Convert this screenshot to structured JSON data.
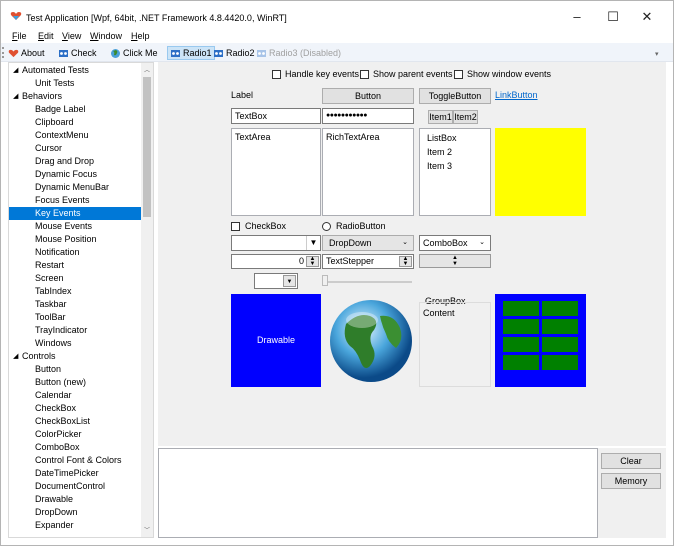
{
  "window": {
    "title": "Test Application [Wpf, 64bit, .NET Framework 4.8.4420.0, WinRT]",
    "minimize": "–",
    "maximize": "☐",
    "close": "✕"
  },
  "menu": {
    "file": {
      "u": "F",
      "rest": "ile"
    },
    "edit": {
      "u": "E",
      "rest": "dit"
    },
    "view": {
      "u": "V",
      "rest": "iew"
    },
    "window": {
      "u": "W",
      "rest": "indow"
    },
    "help": {
      "u": "H",
      "rest": "elp"
    }
  },
  "toolbar": {
    "about": "About",
    "check": "Check",
    "click_me": "Click Me",
    "radio1": "Radio1",
    "radio2": "Radio2",
    "radio3": "Radio3 (Disabled)"
  },
  "tree": {
    "items": [
      {
        "label": "Automated Tests",
        "caret": "◢"
      },
      {
        "label": "Unit Tests"
      },
      {
        "label": "Behaviors",
        "caret": "◢"
      },
      {
        "label": "Badge Label"
      },
      {
        "label": "Clipboard"
      },
      {
        "label": "ContextMenu"
      },
      {
        "label": "Cursor"
      },
      {
        "label": "Drag and Drop"
      },
      {
        "label": "Dynamic Focus"
      },
      {
        "label": "Dynamic MenuBar"
      },
      {
        "label": "Focus Events"
      },
      {
        "label": "Key Events"
      },
      {
        "label": "Mouse Events"
      },
      {
        "label": "Mouse Position"
      },
      {
        "label": "Notification"
      },
      {
        "label": "Restart"
      },
      {
        "label": "Screen"
      },
      {
        "label": "TabIndex"
      },
      {
        "label": "Taskbar"
      },
      {
        "label": "ToolBar"
      },
      {
        "label": "TrayIndicator"
      },
      {
        "label": "Windows"
      },
      {
        "label": "Controls",
        "caret": "◢"
      },
      {
        "label": "Button"
      },
      {
        "label": "Button (new)"
      },
      {
        "label": "Calendar"
      },
      {
        "label": "CheckBox"
      },
      {
        "label": "CheckBoxList"
      },
      {
        "label": "ColorPicker"
      },
      {
        "label": "ComboBox"
      },
      {
        "label": "Control Font & Colors"
      },
      {
        "label": "DateTimePicker"
      },
      {
        "label": "DocumentControl"
      },
      {
        "label": "Drawable"
      },
      {
        "label": "DropDown"
      },
      {
        "label": "Expander"
      }
    ],
    "selected": "Key Events"
  },
  "options": {
    "handle_key": "Handle key events",
    "show_parent": "Show parent events",
    "show_window": "Show window events"
  },
  "controls": {
    "label": "Label",
    "button": "Button",
    "toggle_button": "ToggleButton",
    "link_button": "LinkButton",
    "textbox": "TextBox",
    "password": "●●●●●●●●●●●",
    "seg_item1": "Item1",
    "seg_item2": "Item2",
    "textarea": "TextArea",
    "richtextarea": "RichTextArea",
    "listbox": [
      "ListBox",
      "Item 2",
      "Item 3"
    ],
    "checkbox": "CheckBox",
    "radiobutton": "RadioButton",
    "dropdown": "DropDown",
    "combobox": "ComboBox",
    "numeric_value": "0",
    "textstepper": "TextStepper",
    "drawable": "Drawable",
    "groupbox": "GroupBox",
    "groupbox_content": "Content",
    "yellow": "#ffff00",
    "blue": "#0000ff",
    "green": "#008000"
  },
  "side_buttons": {
    "clear": "Clear",
    "memory": "Memory"
  }
}
